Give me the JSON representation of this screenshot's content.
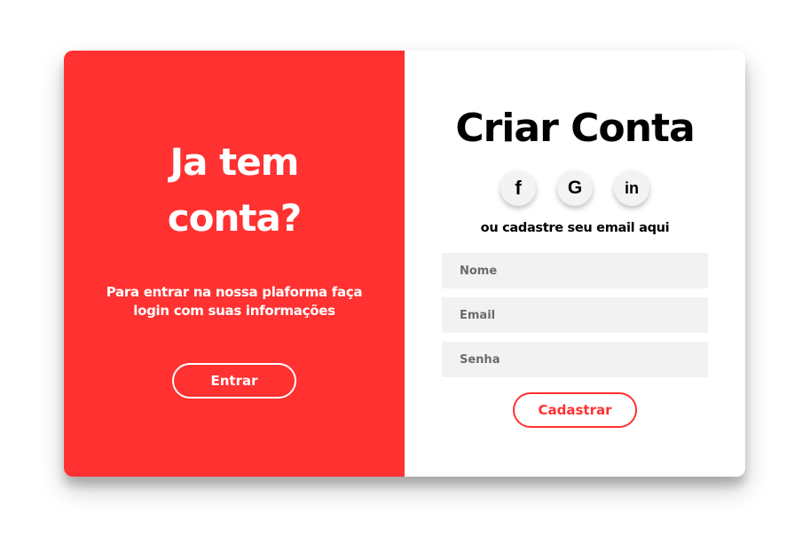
{
  "colors": {
    "accent": "#ff3131",
    "panel_text": "#ffffff",
    "field_background": "#f2f2f2",
    "page_background": "#ffffff"
  },
  "signin_panel": {
    "title_line1": "Ja tem",
    "title_line2": "conta?",
    "message_line1": "Para entrar na nossa plaforma faça",
    "message_line2": "login com suas informações",
    "button_label": "Entrar"
  },
  "signup_form": {
    "title": "Criar Conta",
    "social": [
      {
        "icon": "facebook-icon",
        "glyph": "f"
      },
      {
        "icon": "google-icon",
        "glyph": "G"
      },
      {
        "icon": "linkedin-icon",
        "glyph": "in"
      }
    ],
    "subtitle": "ou cadastre seu email aqui",
    "fields": {
      "name": {
        "placeholder": "Nome",
        "value": ""
      },
      "email": {
        "placeholder": "Email",
        "value": ""
      },
      "password": {
        "placeholder": "Senha",
        "value": ""
      }
    },
    "button_label": "Cadastrar"
  }
}
